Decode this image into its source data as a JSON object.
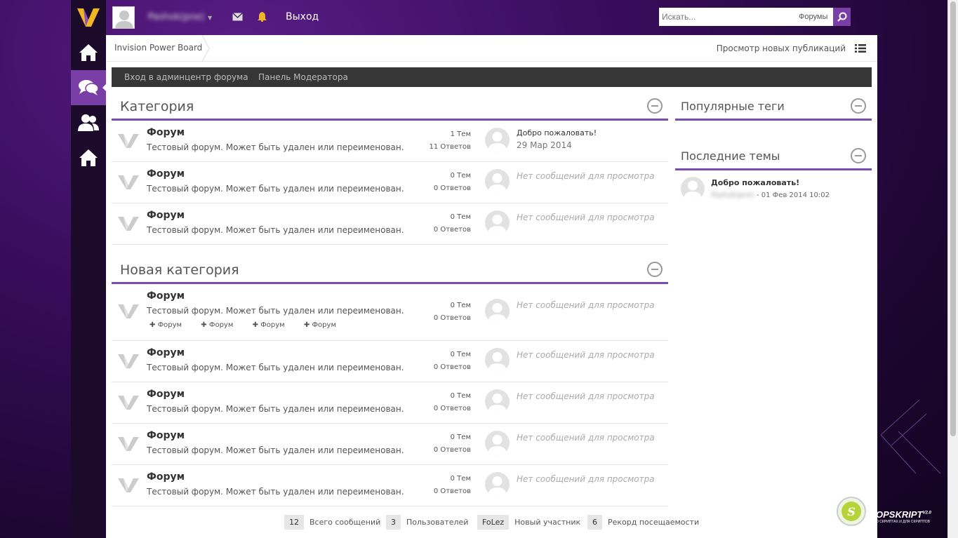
{
  "topbar": {
    "username": "Pashok(pne)",
    "logout": "Выход",
    "search_placeholder": "Искать...",
    "search_scope": "Форумы"
  },
  "breadcrumb": {
    "home": "Invision Power Board",
    "new_posts": "Просмотр новых публикаций"
  },
  "modbar": {
    "admin": "Вход в админцентр форума",
    "moderator": "Панель Модератора"
  },
  "categories": [
    {
      "title": "Категория",
      "forums": [
        {
          "name": "Форум",
          "desc": "Тестовый форум. Может быть удален или переименован.",
          "topics": "1 Тем",
          "replies": "11 Ответов",
          "last_title": "Добро пожаловать!",
          "last_date": "29 Мар 2014"
        },
        {
          "name": "Форум",
          "desc": "Тестовый форум. Может быть удален или переименован.",
          "topics": "0 Тем",
          "replies": "0 Ответов",
          "no_posts": "Нет сообщений для просмотра"
        },
        {
          "name": "Форум",
          "desc": "Тестовый форум. Может быть удален или переименован.",
          "topics": "0 Тем",
          "replies": "0 Ответов",
          "no_posts": "Нет сообщений для просмотра"
        }
      ]
    },
    {
      "title": "Новая категория",
      "forums": [
        {
          "name": "Форум",
          "desc": "Тестовый форум. Может быть удален или переименован.",
          "topics": "0 Тем",
          "replies": "0 Ответов",
          "no_posts": "Нет сообщений для просмотра",
          "subforums": [
            "Форум",
            "Форум",
            "Форум",
            "Форум"
          ]
        },
        {
          "name": "Форум",
          "desc": "Тестовый форум. Может быть удален или переименован.",
          "topics": "0 Тем",
          "replies": "0 Ответов",
          "no_posts": "Нет сообщений для просмотра"
        },
        {
          "name": "Форум",
          "desc": "Тестовый форум. Может быть удален или переименован.",
          "topics": "0 Тем",
          "replies": "0 Ответов",
          "no_posts": "Нет сообщений для просмотра"
        },
        {
          "name": "Форум",
          "desc": "Тестовый форум. Может быть удален или переименован.",
          "topics": "0 Тем",
          "replies": "0 Ответов",
          "no_posts": "Нет сообщений для просмотра"
        },
        {
          "name": "Форум",
          "desc": "Тестовый форум. Может быть удален или переименован.",
          "topics": "0 Тем",
          "replies": "0 Ответов",
          "no_posts": "Нет сообщений для просмотра"
        }
      ]
    }
  ],
  "sidebar": {
    "popular_tags": "Популярные теги",
    "recent_topics": "Последние темы",
    "recent": {
      "title": "Добро пожаловать!",
      "author": "Pashok(pne)",
      "date": " - 01 Фев 2014 10:02"
    }
  },
  "footer": {
    "posts_num": "12",
    "posts_label": "Всего сообщений",
    "users_num": "3",
    "users_label": "Пользователей",
    "newest_num": "FoLez",
    "newest_label": "Новый участник",
    "record_num": "6",
    "record_label": "Рекорд посещаемости"
  },
  "brand": {
    "name": "OPSKRIPT",
    "version": "V2.0",
    "tagline": "О СКРИПТАХ И ДЛЯ СКРИПТОВ"
  },
  "colors": {
    "accent": "#7a4bb0",
    "nav_bg": "#1c0a2b",
    "modbar": "#363636"
  }
}
